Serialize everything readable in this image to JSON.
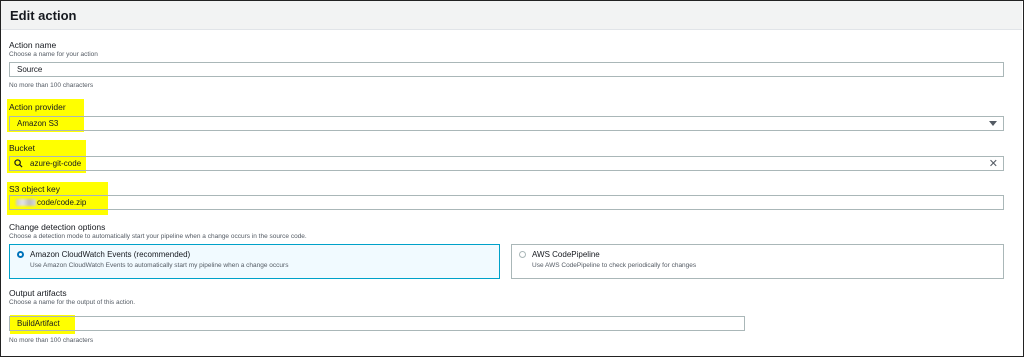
{
  "header": {
    "title": "Edit action"
  },
  "action_name": {
    "label": "Action name",
    "description": "Choose a name for your action",
    "value": "Source",
    "hint": "No more than 100 characters"
  },
  "action_provider": {
    "label": "Action provider",
    "value": "Amazon S3"
  },
  "bucket": {
    "label": "Bucket",
    "value": "azure-git-code"
  },
  "s3_object_key": {
    "label": "S3 object key",
    "value": "code/code.zip"
  },
  "change_detection": {
    "label": "Change detection options",
    "description": "Choose a detection mode to automatically start your pipeline when a change occurs in the source code.",
    "options": [
      {
        "title": "Amazon CloudWatch Events (recommended)",
        "description": "Use Amazon CloudWatch Events to automatically start my pipeline when a change occurs",
        "selected": true
      },
      {
        "title": "AWS CodePipeline",
        "description": "Use AWS CodePipeline to check periodically for changes",
        "selected": false
      }
    ]
  },
  "output_artifacts": {
    "label": "Output artifacts",
    "description": "Choose a name for the output of this action.",
    "value": "BuildArtifact",
    "hint": "No more than 100 characters"
  },
  "colors": {
    "highlight": "#ffff00",
    "accent": "#0073bb",
    "selected_bg": "#f1faff"
  }
}
